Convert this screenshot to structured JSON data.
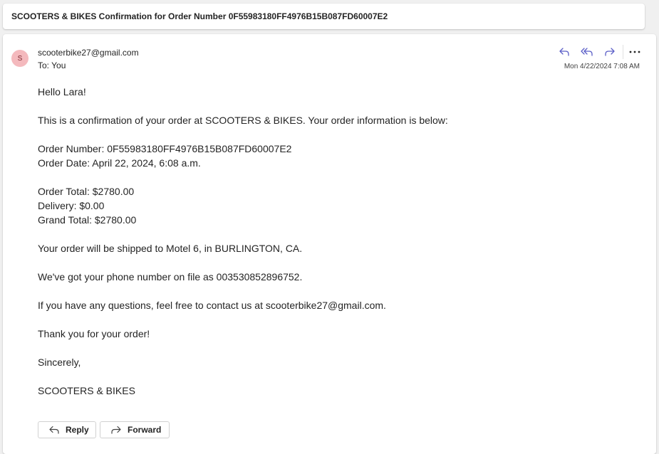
{
  "subject": "SCOOTERS & BIKES Confirmation for Order Number 0F55983180FF4976B15B087FD60007E2",
  "header": {
    "avatar_initial": "S",
    "sender": "scooterbike27@gmail.com",
    "to_label": "To:",
    "to_value": "You",
    "timestamp": "Mon 4/22/2024 7:08 AM"
  },
  "actions": {
    "reply": "reply-icon",
    "reply_all": "reply-all-icon",
    "forward": "forward-icon",
    "more": "more-icon"
  },
  "body": {
    "greeting": "Hello Lara!",
    "intro": "This is a confirmation of your order at SCOOTERS & BIKES. Your order information is below:",
    "order_number": "Order Number: 0F55983180FF4976B15B087FD60007E2",
    "order_date": "Order Date: April 22, 2024, 6:08 a.m.",
    "order_total": "Order Total: $2780.00",
    "delivery": "Delivery: $0.00",
    "grand_total": "Grand Total: $2780.00",
    "shipping": "Your order will be shipped to Motel 6, in BURLINGTON, CA.",
    "phone": "We've got your phone number on file as 003530852896752.",
    "contact": "If you have any questions, feel free to contact us at scooterbike27@gmail.com.",
    "thanks": "Thank you for your order!",
    "closing": "Sincerely,",
    "signature": "SCOOTERS & BIKES"
  },
  "footer": {
    "reply_label": "Reply",
    "forward_label": "Forward"
  },
  "colors": {
    "accent": "#5b5fc7",
    "avatar_bg": "#f4b9bd",
    "avatar_text": "#7a2830"
  }
}
